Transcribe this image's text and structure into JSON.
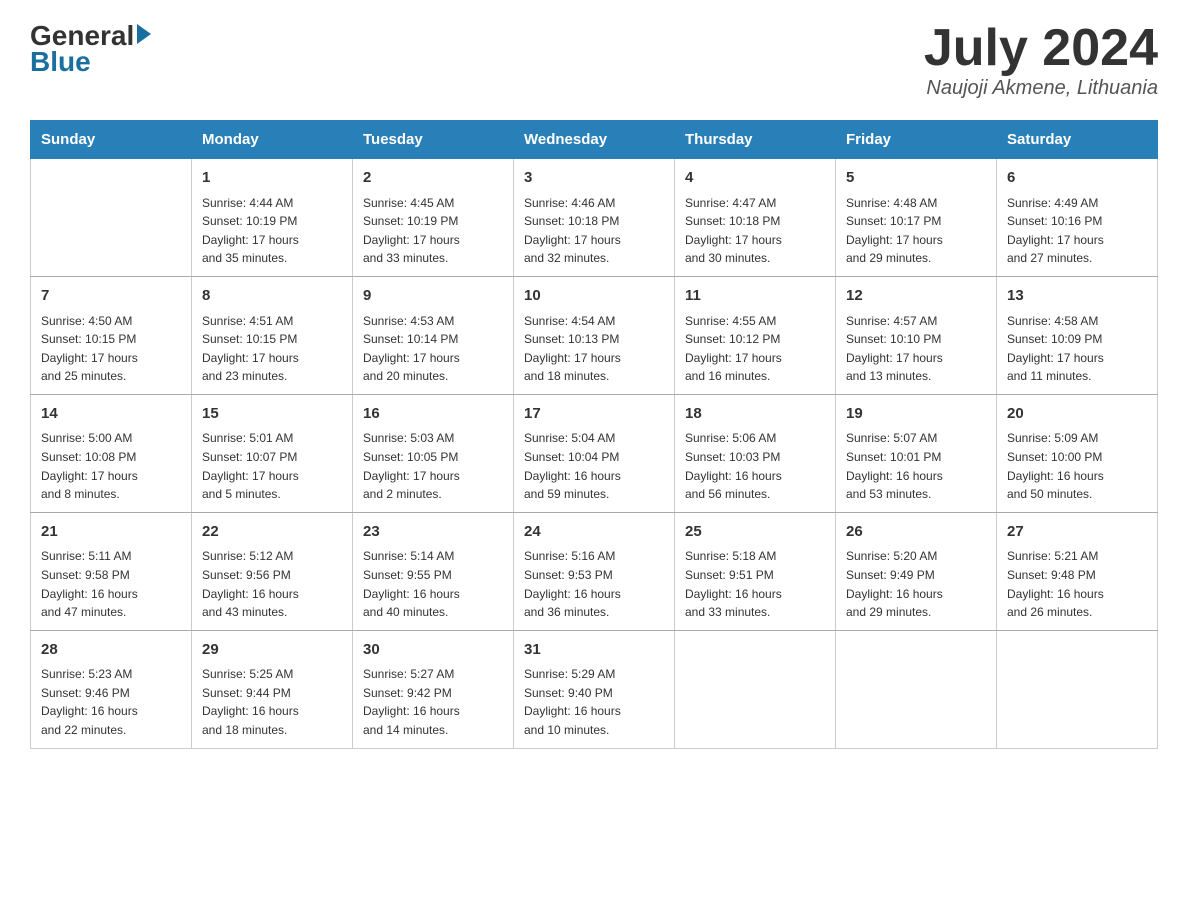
{
  "header": {
    "logo_general": "General",
    "logo_blue": "Blue",
    "month_year": "July 2024",
    "location": "Naujoji Akmene, Lithuania"
  },
  "days_of_week": [
    "Sunday",
    "Monday",
    "Tuesday",
    "Wednesday",
    "Thursday",
    "Friday",
    "Saturday"
  ],
  "weeks": [
    [
      {
        "day": "",
        "info": ""
      },
      {
        "day": "1",
        "info": "Sunrise: 4:44 AM\nSunset: 10:19 PM\nDaylight: 17 hours\nand 35 minutes."
      },
      {
        "day": "2",
        "info": "Sunrise: 4:45 AM\nSunset: 10:19 PM\nDaylight: 17 hours\nand 33 minutes."
      },
      {
        "day": "3",
        "info": "Sunrise: 4:46 AM\nSunset: 10:18 PM\nDaylight: 17 hours\nand 32 minutes."
      },
      {
        "day": "4",
        "info": "Sunrise: 4:47 AM\nSunset: 10:18 PM\nDaylight: 17 hours\nand 30 minutes."
      },
      {
        "day": "5",
        "info": "Sunrise: 4:48 AM\nSunset: 10:17 PM\nDaylight: 17 hours\nand 29 minutes."
      },
      {
        "day": "6",
        "info": "Sunrise: 4:49 AM\nSunset: 10:16 PM\nDaylight: 17 hours\nand 27 minutes."
      }
    ],
    [
      {
        "day": "7",
        "info": "Sunrise: 4:50 AM\nSunset: 10:15 PM\nDaylight: 17 hours\nand 25 minutes."
      },
      {
        "day": "8",
        "info": "Sunrise: 4:51 AM\nSunset: 10:15 PM\nDaylight: 17 hours\nand 23 minutes."
      },
      {
        "day": "9",
        "info": "Sunrise: 4:53 AM\nSunset: 10:14 PM\nDaylight: 17 hours\nand 20 minutes."
      },
      {
        "day": "10",
        "info": "Sunrise: 4:54 AM\nSunset: 10:13 PM\nDaylight: 17 hours\nand 18 minutes."
      },
      {
        "day": "11",
        "info": "Sunrise: 4:55 AM\nSunset: 10:12 PM\nDaylight: 17 hours\nand 16 minutes."
      },
      {
        "day": "12",
        "info": "Sunrise: 4:57 AM\nSunset: 10:10 PM\nDaylight: 17 hours\nand 13 minutes."
      },
      {
        "day": "13",
        "info": "Sunrise: 4:58 AM\nSunset: 10:09 PM\nDaylight: 17 hours\nand 11 minutes."
      }
    ],
    [
      {
        "day": "14",
        "info": "Sunrise: 5:00 AM\nSunset: 10:08 PM\nDaylight: 17 hours\nand 8 minutes."
      },
      {
        "day": "15",
        "info": "Sunrise: 5:01 AM\nSunset: 10:07 PM\nDaylight: 17 hours\nand 5 minutes."
      },
      {
        "day": "16",
        "info": "Sunrise: 5:03 AM\nSunset: 10:05 PM\nDaylight: 17 hours\nand 2 minutes."
      },
      {
        "day": "17",
        "info": "Sunrise: 5:04 AM\nSunset: 10:04 PM\nDaylight: 16 hours\nand 59 minutes."
      },
      {
        "day": "18",
        "info": "Sunrise: 5:06 AM\nSunset: 10:03 PM\nDaylight: 16 hours\nand 56 minutes."
      },
      {
        "day": "19",
        "info": "Sunrise: 5:07 AM\nSunset: 10:01 PM\nDaylight: 16 hours\nand 53 minutes."
      },
      {
        "day": "20",
        "info": "Sunrise: 5:09 AM\nSunset: 10:00 PM\nDaylight: 16 hours\nand 50 minutes."
      }
    ],
    [
      {
        "day": "21",
        "info": "Sunrise: 5:11 AM\nSunset: 9:58 PM\nDaylight: 16 hours\nand 47 minutes."
      },
      {
        "day": "22",
        "info": "Sunrise: 5:12 AM\nSunset: 9:56 PM\nDaylight: 16 hours\nand 43 minutes."
      },
      {
        "day": "23",
        "info": "Sunrise: 5:14 AM\nSunset: 9:55 PM\nDaylight: 16 hours\nand 40 minutes."
      },
      {
        "day": "24",
        "info": "Sunrise: 5:16 AM\nSunset: 9:53 PM\nDaylight: 16 hours\nand 36 minutes."
      },
      {
        "day": "25",
        "info": "Sunrise: 5:18 AM\nSunset: 9:51 PM\nDaylight: 16 hours\nand 33 minutes."
      },
      {
        "day": "26",
        "info": "Sunrise: 5:20 AM\nSunset: 9:49 PM\nDaylight: 16 hours\nand 29 minutes."
      },
      {
        "day": "27",
        "info": "Sunrise: 5:21 AM\nSunset: 9:48 PM\nDaylight: 16 hours\nand 26 minutes."
      }
    ],
    [
      {
        "day": "28",
        "info": "Sunrise: 5:23 AM\nSunset: 9:46 PM\nDaylight: 16 hours\nand 22 minutes."
      },
      {
        "day": "29",
        "info": "Sunrise: 5:25 AM\nSunset: 9:44 PM\nDaylight: 16 hours\nand 18 minutes."
      },
      {
        "day": "30",
        "info": "Sunrise: 5:27 AM\nSunset: 9:42 PM\nDaylight: 16 hours\nand 14 minutes."
      },
      {
        "day": "31",
        "info": "Sunrise: 5:29 AM\nSunset: 9:40 PM\nDaylight: 16 hours\nand 10 minutes."
      },
      {
        "day": "",
        "info": ""
      },
      {
        "day": "",
        "info": ""
      },
      {
        "day": "",
        "info": ""
      }
    ]
  ]
}
